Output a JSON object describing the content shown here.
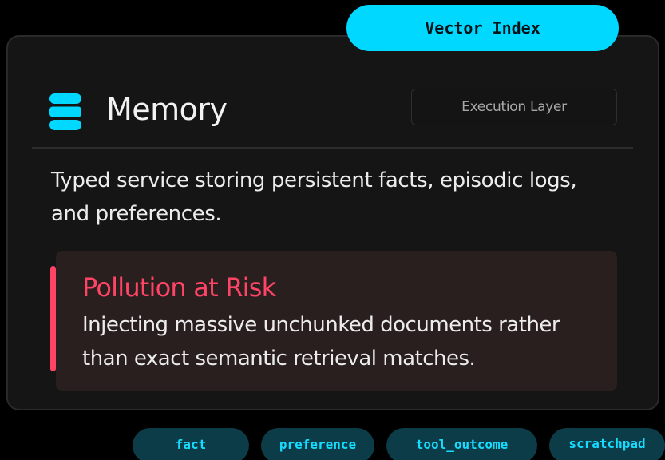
{
  "index_pill": {
    "label": "Vector Index"
  },
  "card": {
    "icon": "database-icon",
    "title": "Memory",
    "layer_badge": "Execution Layer",
    "description": "Typed service storing persistent facts, episodic logs, and preferences.",
    "risk": {
      "title": "Pollution at Risk",
      "text": "Injecting massive unchunked documents rather than exact semantic retrieval matches."
    }
  },
  "tags": [
    "fact",
    "preference",
    "tool_outcome",
    "scratchpad"
  ],
  "colors": {
    "accent": "#00d8ff",
    "risk": "#ff4466",
    "tag_bg": "#0c3c47",
    "tag_text": "#16dcff",
    "card_bg": "#151515"
  }
}
